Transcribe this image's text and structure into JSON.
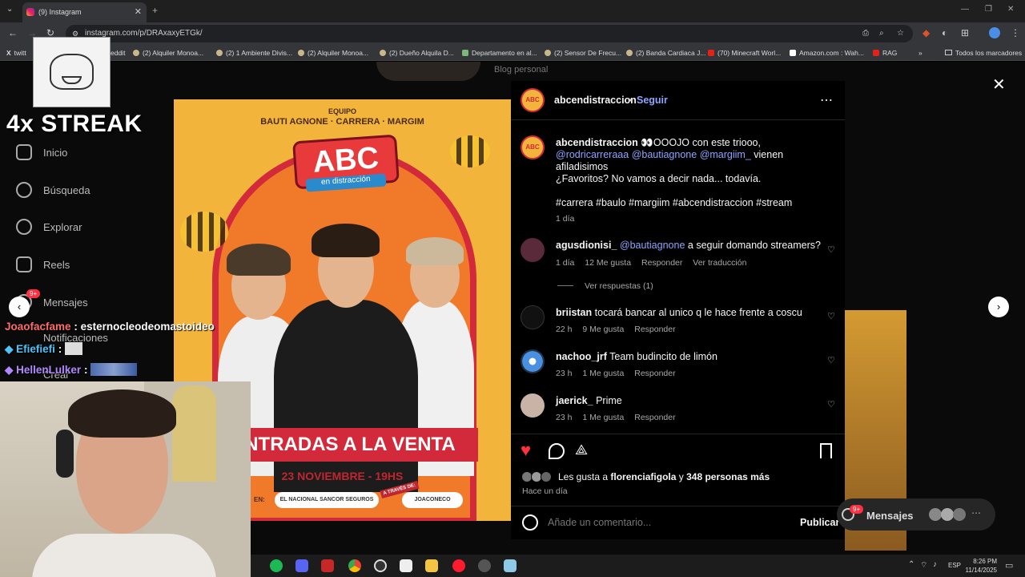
{
  "browser": {
    "tab_title": "(9) Instagram",
    "url": "instagram.com/p/DRAxaxyETGk/",
    "bookmarks": [
      "twitt",
      "eddit",
      "(2) Alquiler Monoa...",
      "(2) 1 Ambiente Divis...",
      "(2) Alquiler Monoa...",
      "(2) Dueño Alquila D...",
      "Departamento en al...",
      "(2) Sensor De Frecu...",
      "(2) Banda Cardiaca J...",
      "(70) Minecraft Worl...",
      "Amazon.com : Wah...",
      "RAG",
      "Todos los marcadores"
    ]
  },
  "overlay": {
    "streak": "4x STREAK",
    "chat": [
      {
        "user": "Joaofacfame",
        "msg": "esternocleodeomastoideo"
      },
      {
        "user": "Efiefiefi",
        "msg": ""
      },
      {
        "user": "HellenLulker",
        "msg": ""
      }
    ]
  },
  "sidebar": {
    "items": [
      "Inicio",
      "Búsqueda",
      "Explorar",
      "Reels",
      "Mensajes",
      "Notificaciones",
      "Crear"
    ],
    "messages_badge": "9+",
    "behind_text": "Blog personal"
  },
  "post_image": {
    "equipo": "EQUIPO",
    "names": "BAUTI AGNONE · CARRERA · MARGIM",
    "logo_top": "ABC",
    "logo_bottom": "en distracción",
    "entradas": "NTRADAS A LA VENTA",
    "fecha": "23 NOVIEMBRE  -  19HS",
    "en": "EN:",
    "venue": "EL NACIONAL  SANCOR SEGUROS",
    "channel": "JOACONECO",
    "a_traves": "A TRAVÉS DE:"
  },
  "post": {
    "account": "abcendistraccion",
    "follow": "Seguir",
    "caption_user": "abcendistraccion",
    "caption_part1": "👀OOOJO con este triooo,",
    "mention1": "@rodricarreraaa",
    "mention2": "@bautiagnone",
    "mention3": "@margiim_",
    "caption_part2": "vienen afiladisimos",
    "caption_line2": "¿Favoritos? No vamos a decir nada... todavía.",
    "hashtags": "#carrera #baulo #margiim #abcendistraccion #stream",
    "caption_time": "1 día",
    "comments": [
      {
        "user": "agusdionisi_",
        "mention": "@bautiagnone",
        "text": "a seguir domando streamers?",
        "time": "1 día",
        "likes": "12 Me gusta",
        "reply": "Responder",
        "translate": "Ver traducción",
        "replies": "Ver respuestas (1)"
      },
      {
        "user": "briistan",
        "text": "tocará bancar al unico q le hace frente a coscu",
        "time": "22 h",
        "likes": "9 Me gusta",
        "reply": "Responder"
      },
      {
        "user": "nachoo_jrf",
        "text": "Team budincito de limón",
        "time": "23 h",
        "likes": "1 Me gusta",
        "reply": "Responder"
      },
      {
        "user": "jaerick_",
        "text": "Prime",
        "time": "23 h",
        "likes": "1 Me gusta",
        "reply": "Responder"
      }
    ],
    "likes_prefix": "Les gusta a",
    "likes_user": "florenciafigola",
    "likes_and": "y",
    "likes_rest": "348 personas más",
    "posted": "Hace un día",
    "comment_placeholder": "Añade un comentario...",
    "publish": "Publicar"
  },
  "floating_messages": {
    "label": "Mensajes",
    "badge": "9+"
  },
  "taskbar": {
    "lang": "ESP",
    "time": "8:26 PM",
    "date": "11/14/2025"
  },
  "colors": {
    "accent_blue": "#8da5ff",
    "heart_red": "#ff3040",
    "panel_bg": "#000000"
  }
}
